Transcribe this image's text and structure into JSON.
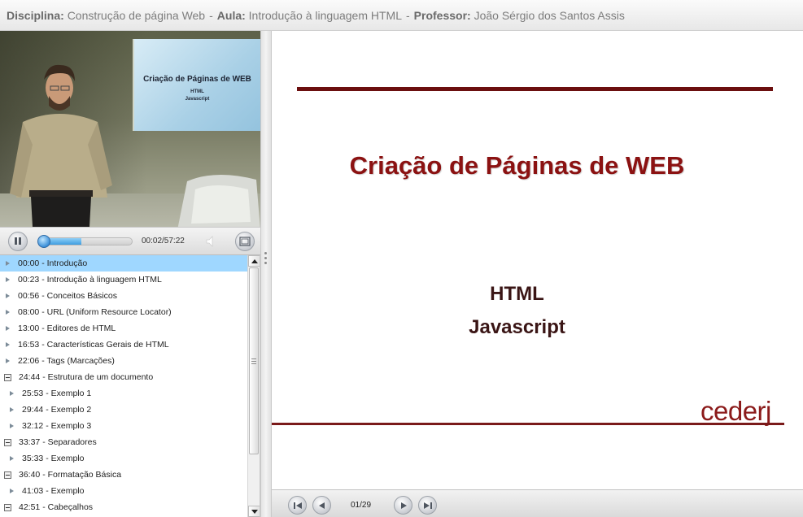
{
  "header": {
    "course_label": "Disciplina:",
    "course_value": "Construção de página Web",
    "lesson_label": "Aula:",
    "lesson_value": "Introdução à linguagem HTML",
    "teacher_label": "Professor:",
    "teacher_value": "João Sérgio dos Santos Assis",
    "separator": "-"
  },
  "video": {
    "screen_title": "Criação de Páginas de WEB",
    "screen_line1": "HTML",
    "screen_line2": "Javascript"
  },
  "player": {
    "time": "00:02/57:22",
    "progress_fraction": 0.45
  },
  "chapters": [
    {
      "label": "00:00 - Introdução",
      "kind": "leaf",
      "selected": true
    },
    {
      "label": "00:23 - Introdução à linguagem HTML",
      "kind": "leaf"
    },
    {
      "label": "00:56 - Conceitos Básicos",
      "kind": "leaf"
    },
    {
      "label": "08:00 - URL (Uniform Resource Locator)",
      "kind": "leaf"
    },
    {
      "label": "13:00 - Editores de HTML",
      "kind": "leaf"
    },
    {
      "label": "16:53 - Características Gerais de HTML",
      "kind": "leaf"
    },
    {
      "label": "22:06 - Tags (Marcações)",
      "kind": "leaf"
    },
    {
      "label": "24:44 - Estrutura de um documento",
      "kind": "group"
    },
    {
      "label": "25:53 - Exemplo 1",
      "kind": "child"
    },
    {
      "label": "29:44 - Exemplo 2",
      "kind": "child"
    },
    {
      "label": "32:12 - Exemplo 3",
      "kind": "child"
    },
    {
      "label": "33:37 - Separadores",
      "kind": "group"
    },
    {
      "label": "35:33 - Exemplo",
      "kind": "child"
    },
    {
      "label": "36:40 - Formatação Básica",
      "kind": "group"
    },
    {
      "label": "41:03 - Exemplo",
      "kind": "child"
    },
    {
      "label": "42:51 - Cabeçalhos",
      "kind": "group"
    }
  ],
  "slide": {
    "title": "Criação de Páginas de WEB",
    "line1": "HTML",
    "line2": "Javascript",
    "logo": "cederj",
    "page": "01/29"
  },
  "colors": {
    "slide_title": "#8b1212",
    "slide_rule": "#6b0f0f",
    "selected_row": "#9fd7ff",
    "progress": "#3f9de0"
  },
  "icons": {
    "pause": "pause-icon",
    "volume": "volume-icon",
    "fullscreen": "fullscreen-icon",
    "first": "first-page-icon",
    "prev": "previous-page-icon",
    "next": "next-page-icon",
    "last": "last-page-icon"
  }
}
